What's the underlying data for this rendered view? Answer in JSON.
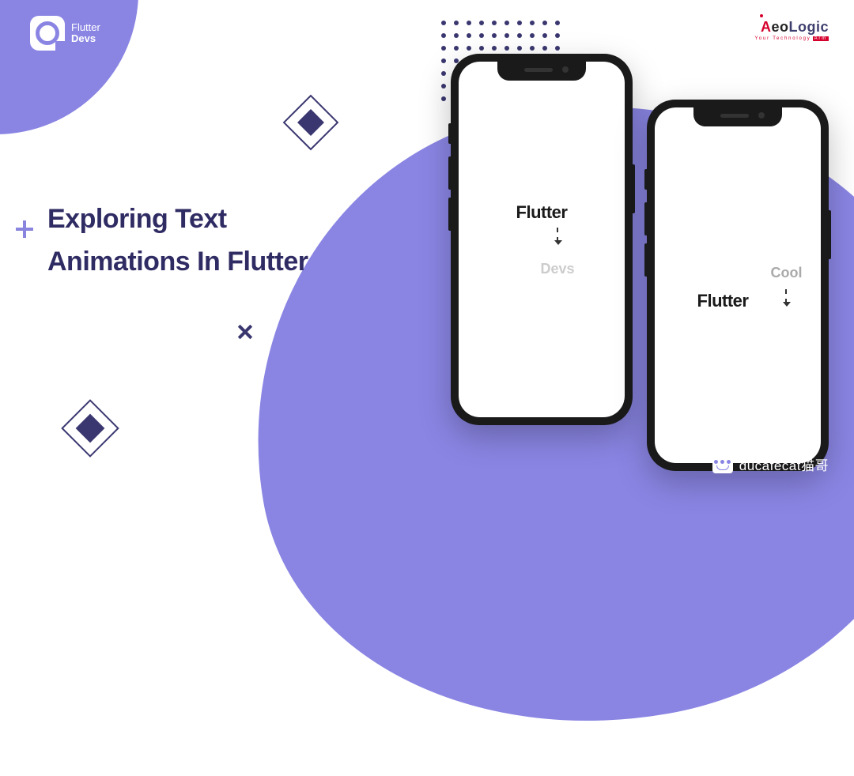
{
  "title_line1": "Exploring Text",
  "title_line2": "Animations In Flutter",
  "flutterdevs_logo": {
    "line1": "Flutter",
    "line2": "Devs"
  },
  "aeologic_logo": {
    "a": "A",
    "eo": "eo",
    "logic": "Logic",
    "tagline": "Your Technology",
    "tagline_badge": "Arm"
  },
  "phone1": {
    "word": "Flutter",
    "subword": "Devs"
  },
  "phone2": {
    "word": "Flutter",
    "subword": "Cool"
  },
  "watermark": "ducafecat猫哥"
}
